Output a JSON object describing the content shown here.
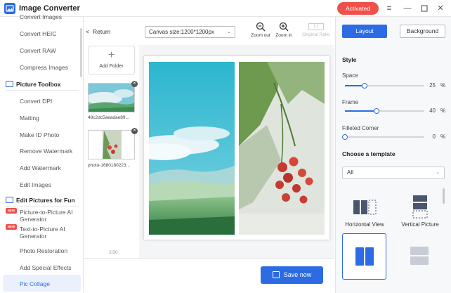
{
  "app": {
    "title": "Image Converter",
    "activated_label": "Activated"
  },
  "sidebar": {
    "items_top": [
      "Convert Images",
      "Convert HEIC",
      "Convert RAW",
      "Compress Images"
    ],
    "section1": "Picture Toolbox",
    "items_mid": [
      "Convert DPI",
      "Matting",
      "Make ID Photo",
      "Remove Watermark",
      "Add Watermark",
      "Edit Images"
    ],
    "section2": "Edit Pictures for Fun",
    "new_badge": "NEW",
    "item_p2p": "Picture-to-Picture AI Generator",
    "item_t2p": "Text-to-Picture AI Generator",
    "items_bottom": [
      "Photo Restoration",
      "Add Special Effects",
      "Pic Collage"
    ]
  },
  "toolbar": {
    "return_label": "Return",
    "canvas_size": "Canvas size:1200*1200px",
    "zoom_out": "Zoom out",
    "zoom_in": "Zoom in",
    "ratio_value": "1:1",
    "original_ratio": "Original Ratio"
  },
  "files": {
    "add_folder": "Add Folder",
    "thumbs": [
      "48c2dc5aeadae89...",
      "photo-1680180223..."
    ],
    "page_count": "2/30"
  },
  "save_label": "Save now",
  "panel": {
    "tab_layout": "Layout",
    "tab_background": "Background",
    "style_heading": "Style",
    "space_label": "Space",
    "space_value": "25",
    "space_fraction": 0.25,
    "frame_label": "Frame",
    "frame_value": "40",
    "frame_fraction": 0.4,
    "corner_label": "Filleted Corner",
    "corner_value": "0",
    "corner_fraction": 0,
    "unit": "%",
    "template_heading": "Choose a template",
    "template_filter": "All",
    "templates": [
      "Horizontal View",
      "Vertical Picture"
    ]
  },
  "colors": {
    "accent": "#2d6be4",
    "activated": "#f0504a"
  }
}
